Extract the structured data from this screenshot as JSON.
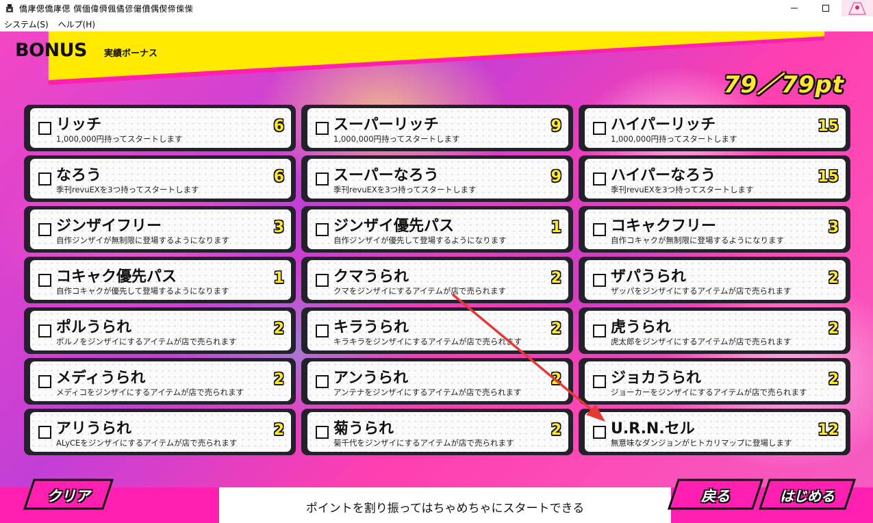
{
  "window": {
    "title": "僑庨偲僑庨偲 僎偭偉僢偑僪偐僒僨偶偰偙偨偨",
    "minimize_icon": "minimize-icon",
    "maximize_icon": "maximize-icon",
    "close_icon": "close-icon"
  },
  "menu": {
    "system": "システム(S)",
    "help": "ヘルプ(H)"
  },
  "header": {
    "title": "BONUS",
    "subtitle": "実績ボーナス",
    "points": "79／79pt"
  },
  "colors": {
    "banner_yellow": "#ffea00",
    "magenta": "#ff1fb0",
    "cost_yellow": "#ffe833",
    "card_frame": "#24212c",
    "annotation_arrow": "#e53935"
  },
  "bonuses": [
    {
      "name": "リッチ",
      "desc": "1,000,000円持ってスタートします",
      "cost": "6"
    },
    {
      "name": "スーパーリッチ",
      "desc": "1,000,000円持ってスタートします",
      "cost": "9"
    },
    {
      "name": "ハイパーリッチ",
      "desc": "1,000,000円持ってスタートします",
      "cost": "15"
    },
    {
      "name": "なろう",
      "desc": "季刊revuEXを3つ持ってスタートします",
      "cost": "6"
    },
    {
      "name": "スーパーなろう",
      "desc": "季刊revuEXを3つ持ってスタートします",
      "cost": "9"
    },
    {
      "name": "ハイパーなろう",
      "desc": "季刊revuEXを3つ持ってスタートします",
      "cost": "15"
    },
    {
      "name": "ジンザイフリー",
      "desc": "自作ジンザイが無制限に登場するようになります",
      "cost": "3"
    },
    {
      "name": "ジンザイ優先パス",
      "desc": "自作ジンザイが優先して登場するようになります",
      "cost": "1"
    },
    {
      "name": "コキャクフリー",
      "desc": "自作コキャクが無制限に登場するようになります",
      "cost": "3"
    },
    {
      "name": "コキャク優先パス",
      "desc": "自作コキャクが優先して登場するようになります",
      "cost": "1"
    },
    {
      "name": "クマうられ",
      "desc": "クマをジンザイにするアイテムが店で売られます",
      "cost": "2"
    },
    {
      "name": "ザパうられ",
      "desc": "ザッパをジンザイにするアイテムが店で売られます",
      "cost": "2"
    },
    {
      "name": "ポルうられ",
      "desc": "ポルノをジンザイにするアイテムが店で売られます",
      "cost": "2"
    },
    {
      "name": "キラうられ",
      "desc": "キラキラをジンザイにするアイテムが店で売られます",
      "cost": "2"
    },
    {
      "name": "虎うられ",
      "desc": "虎太郎をジンザイにするアイテムが店で売られます",
      "cost": "2"
    },
    {
      "name": "メディうられ",
      "desc": "メディコをジンザイにするアイテムが店で売られます",
      "cost": "2"
    },
    {
      "name": "アンうられ",
      "desc": "アンテナをジンザイにするアイテムが店で売られます",
      "cost": "2"
    },
    {
      "name": "ジョカうられ",
      "desc": "ジョーカーをジンザイにするアイテムが店で売られます",
      "cost": "2"
    },
    {
      "name": "アリうられ",
      "desc": "ALyCEをジンザイにするアイテムが店で売られます",
      "cost": "2"
    },
    {
      "name": "菊うられ",
      "desc": "菊千代をジンザイにするアイテムが店で売られます",
      "cost": "2"
    },
    {
      "name": "U.R.N.セル",
      "desc": "無意味なダンジョンがヒトカリマップに登場します",
      "cost": "12"
    }
  ],
  "footer": {
    "clear_label": "クリア",
    "hint": "ポイントを割り振ってはちゃめちゃにスタートできる",
    "back_label": "戻る",
    "start_label": "はじめる"
  }
}
